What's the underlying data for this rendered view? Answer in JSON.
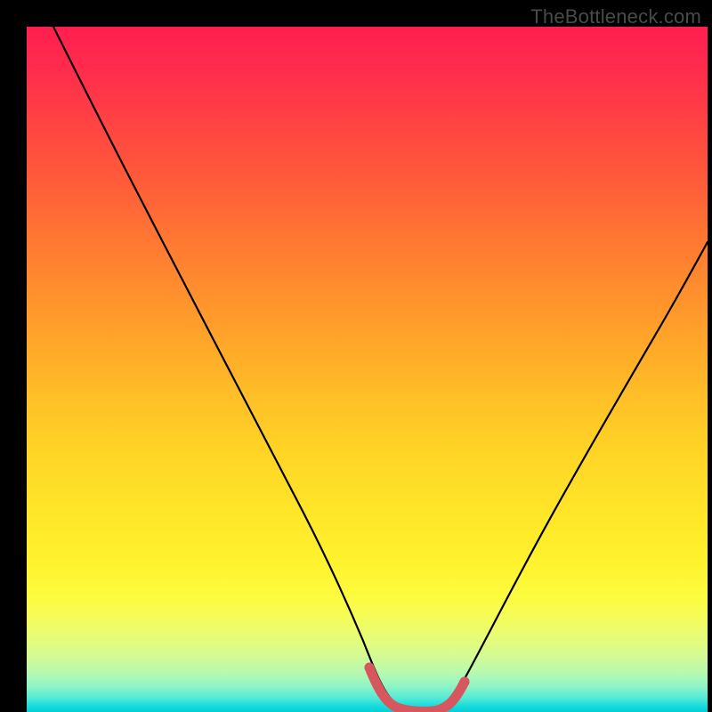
{
  "watermark": "TheBottleneck.com",
  "colors": {
    "frame": "#000000",
    "curve": "#000000",
    "highlight": "#d6585e",
    "watermark_text": "#4a4a4a"
  },
  "chart_data": {
    "type": "line",
    "title": "",
    "xlabel": "",
    "ylabel": "",
    "xlim": [
      0,
      100
    ],
    "ylim": [
      0,
      100
    ],
    "grid": false,
    "legend": false,
    "series": [
      {
        "name": "bottleneck-curve",
        "x": [
          4,
          8,
          12,
          16,
          20,
          24,
          28,
          32,
          36,
          40,
          44,
          48,
          50.5,
          53,
          56,
          59,
          62,
          66,
          70,
          75,
          80,
          85,
          90,
          95,
          100
        ],
        "y": [
          100,
          93,
          85.5,
          77.5,
          69.5,
          61.5,
          53.5,
          45.5,
          37.5,
          29.5,
          21.5,
          13.5,
          6.8,
          2.5,
          0.8,
          0.5,
          1.2,
          4.5,
          10.5,
          18.5,
          26.5,
          34.5,
          42.5,
          50.5,
          58.5
        ]
      }
    ],
    "highlight_segment": {
      "name": "optimal-range",
      "x": [
        50.5,
        53,
        56,
        59,
        62
      ],
      "y": [
        6.8,
        2.5,
        0.8,
        0.5,
        1.2
      ]
    }
  }
}
